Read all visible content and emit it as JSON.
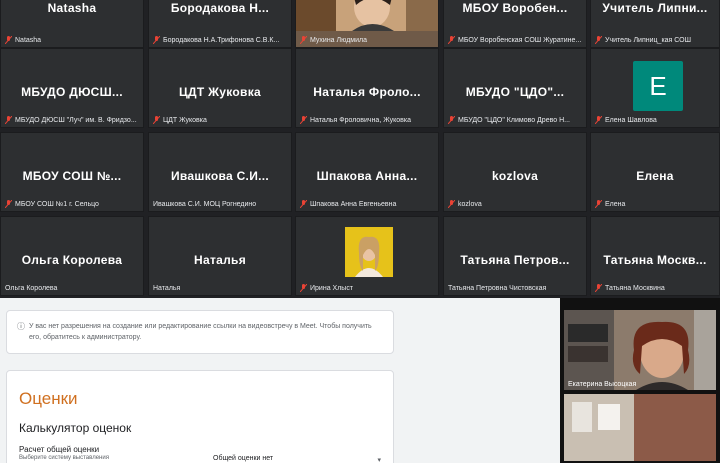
{
  "tiles": [
    {
      "big": "Natasha",
      "foot": "Natasha"
    },
    {
      "big": "Бородакова Н...",
      "foot": "Бородакова Н.А.Трифонова С.В.К..."
    },
    {
      "big": "",
      "foot": "Мухина Людмила"
    },
    {
      "big": "МБОУ Воробен...",
      "foot": "МБОУ Воробенская СОШ Журатине..."
    },
    {
      "big": "Учитель Липни...",
      "foot": "Учитель Липниц_кая СОШ"
    },
    {
      "big": "МБУДО ДЮСШ...",
      "foot": "МБУДО ДЮСШ \"Луч\" им. В. Фридзо..."
    },
    {
      "big": "ЦДТ Жуковка",
      "foot": "ЦДТ Жуковка"
    },
    {
      "big": "Наталья Фроло...",
      "foot": "Наталья Фроловична, Жуковка"
    },
    {
      "big": "МБУДО \"ЦДО\"...",
      "foot": "МБУДО \"ЦДО\" Климово Древо Н..."
    },
    {
      "big": "",
      "foot": "Елена Шавлова",
      "avatar": "E"
    },
    {
      "big": "МБОУ СОШ №...",
      "foot": "МБОУ СОШ №1 г. Сельцо"
    },
    {
      "big": "Ивашкова С.И...",
      "foot": "Ивашкова С.И. МОЦ Рогнедино"
    },
    {
      "big": "Шпакова Анна...",
      "foot": "Шпакова Анна Евгеньевна"
    },
    {
      "big": "kozlova",
      "foot": "kozlova"
    },
    {
      "big": "Елена",
      "foot": "Елена"
    },
    {
      "big": "Ольга Королева",
      "foot": "Ольга Королева"
    },
    {
      "big": "Наталья",
      "foot": "Наталья"
    },
    {
      "big": "",
      "foot": "Ирина Хлыст"
    },
    {
      "big": "Татьяна Петров...",
      "foot": "Татьяна Петровна Чистовская"
    },
    {
      "big": "Татьяна Москв...",
      "foot": "Татьяна Москвина"
    }
  ],
  "notice": {
    "text": "У вас нет разрешения на создание или редактирование ссылки на видеовстречу в Meet. Чтобы получить его, обратитесь к администратору."
  },
  "card": {
    "title": "Оценки",
    "subtitle": "Калькулятор оценок",
    "field_label": "Расчет общей оценки",
    "field_hint": "Выберите систему выставления",
    "select_value": "Общей оценки нет"
  },
  "side": {
    "cam1_name": "Екатерина Высоцкая"
  },
  "colors": {
    "grid_bg": "#202124",
    "tile_bg": "#2d2f31",
    "avatar_green": "#00897b",
    "accent_orange": "#d07020",
    "mic_off_red": "#ea4335"
  }
}
